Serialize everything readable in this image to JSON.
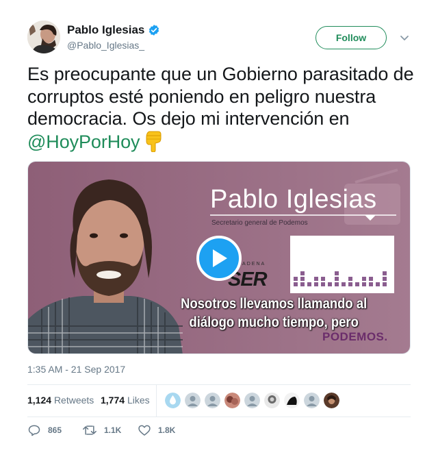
{
  "author": {
    "name": "Pablo Iglesias",
    "handle": "@Pablo_Iglesias_",
    "verified": true,
    "avatar_icon": "profile-photo"
  },
  "follow_label": "Follow",
  "tweet": {
    "text_before": "Es preocupante que un Gobierno parasitado de corruptos esté poniendo en peligro nuestra democracia. Os dejo mi intervención en ",
    "mention": "@HoyPorHoy",
    "emoji": "backhand-index-pointing-down"
  },
  "media": {
    "title": "Pablo Iglesias",
    "subtitle": "Secretario general de Podemos",
    "cadena": "CADENA",
    "station": "SER",
    "caption_line1": "Nosotros llevamos llamando al",
    "caption_line2": "diálogo mucho tiempo, pero",
    "brand": "PODEMOS."
  },
  "timestamp": "1:35 AM - 21 Sep 2017",
  "stats": {
    "retweets_count": "1,124",
    "retweets_label": "Retweets",
    "likes_count": "1,774",
    "likes_label": "Likes"
  },
  "likers": [
    "avatar-1",
    "avatar-2",
    "avatar-3",
    "avatar-4",
    "avatar-5",
    "avatar-6",
    "avatar-7",
    "avatar-8",
    "avatar-9"
  ],
  "actions": {
    "replies": "865",
    "retweets": "1.1K",
    "likes": "1.8K"
  },
  "colors": {
    "accent": "#1f8c5a",
    "play": "#1da1f2",
    "media_bg": "#9b6f85",
    "muted": "#657786"
  }
}
